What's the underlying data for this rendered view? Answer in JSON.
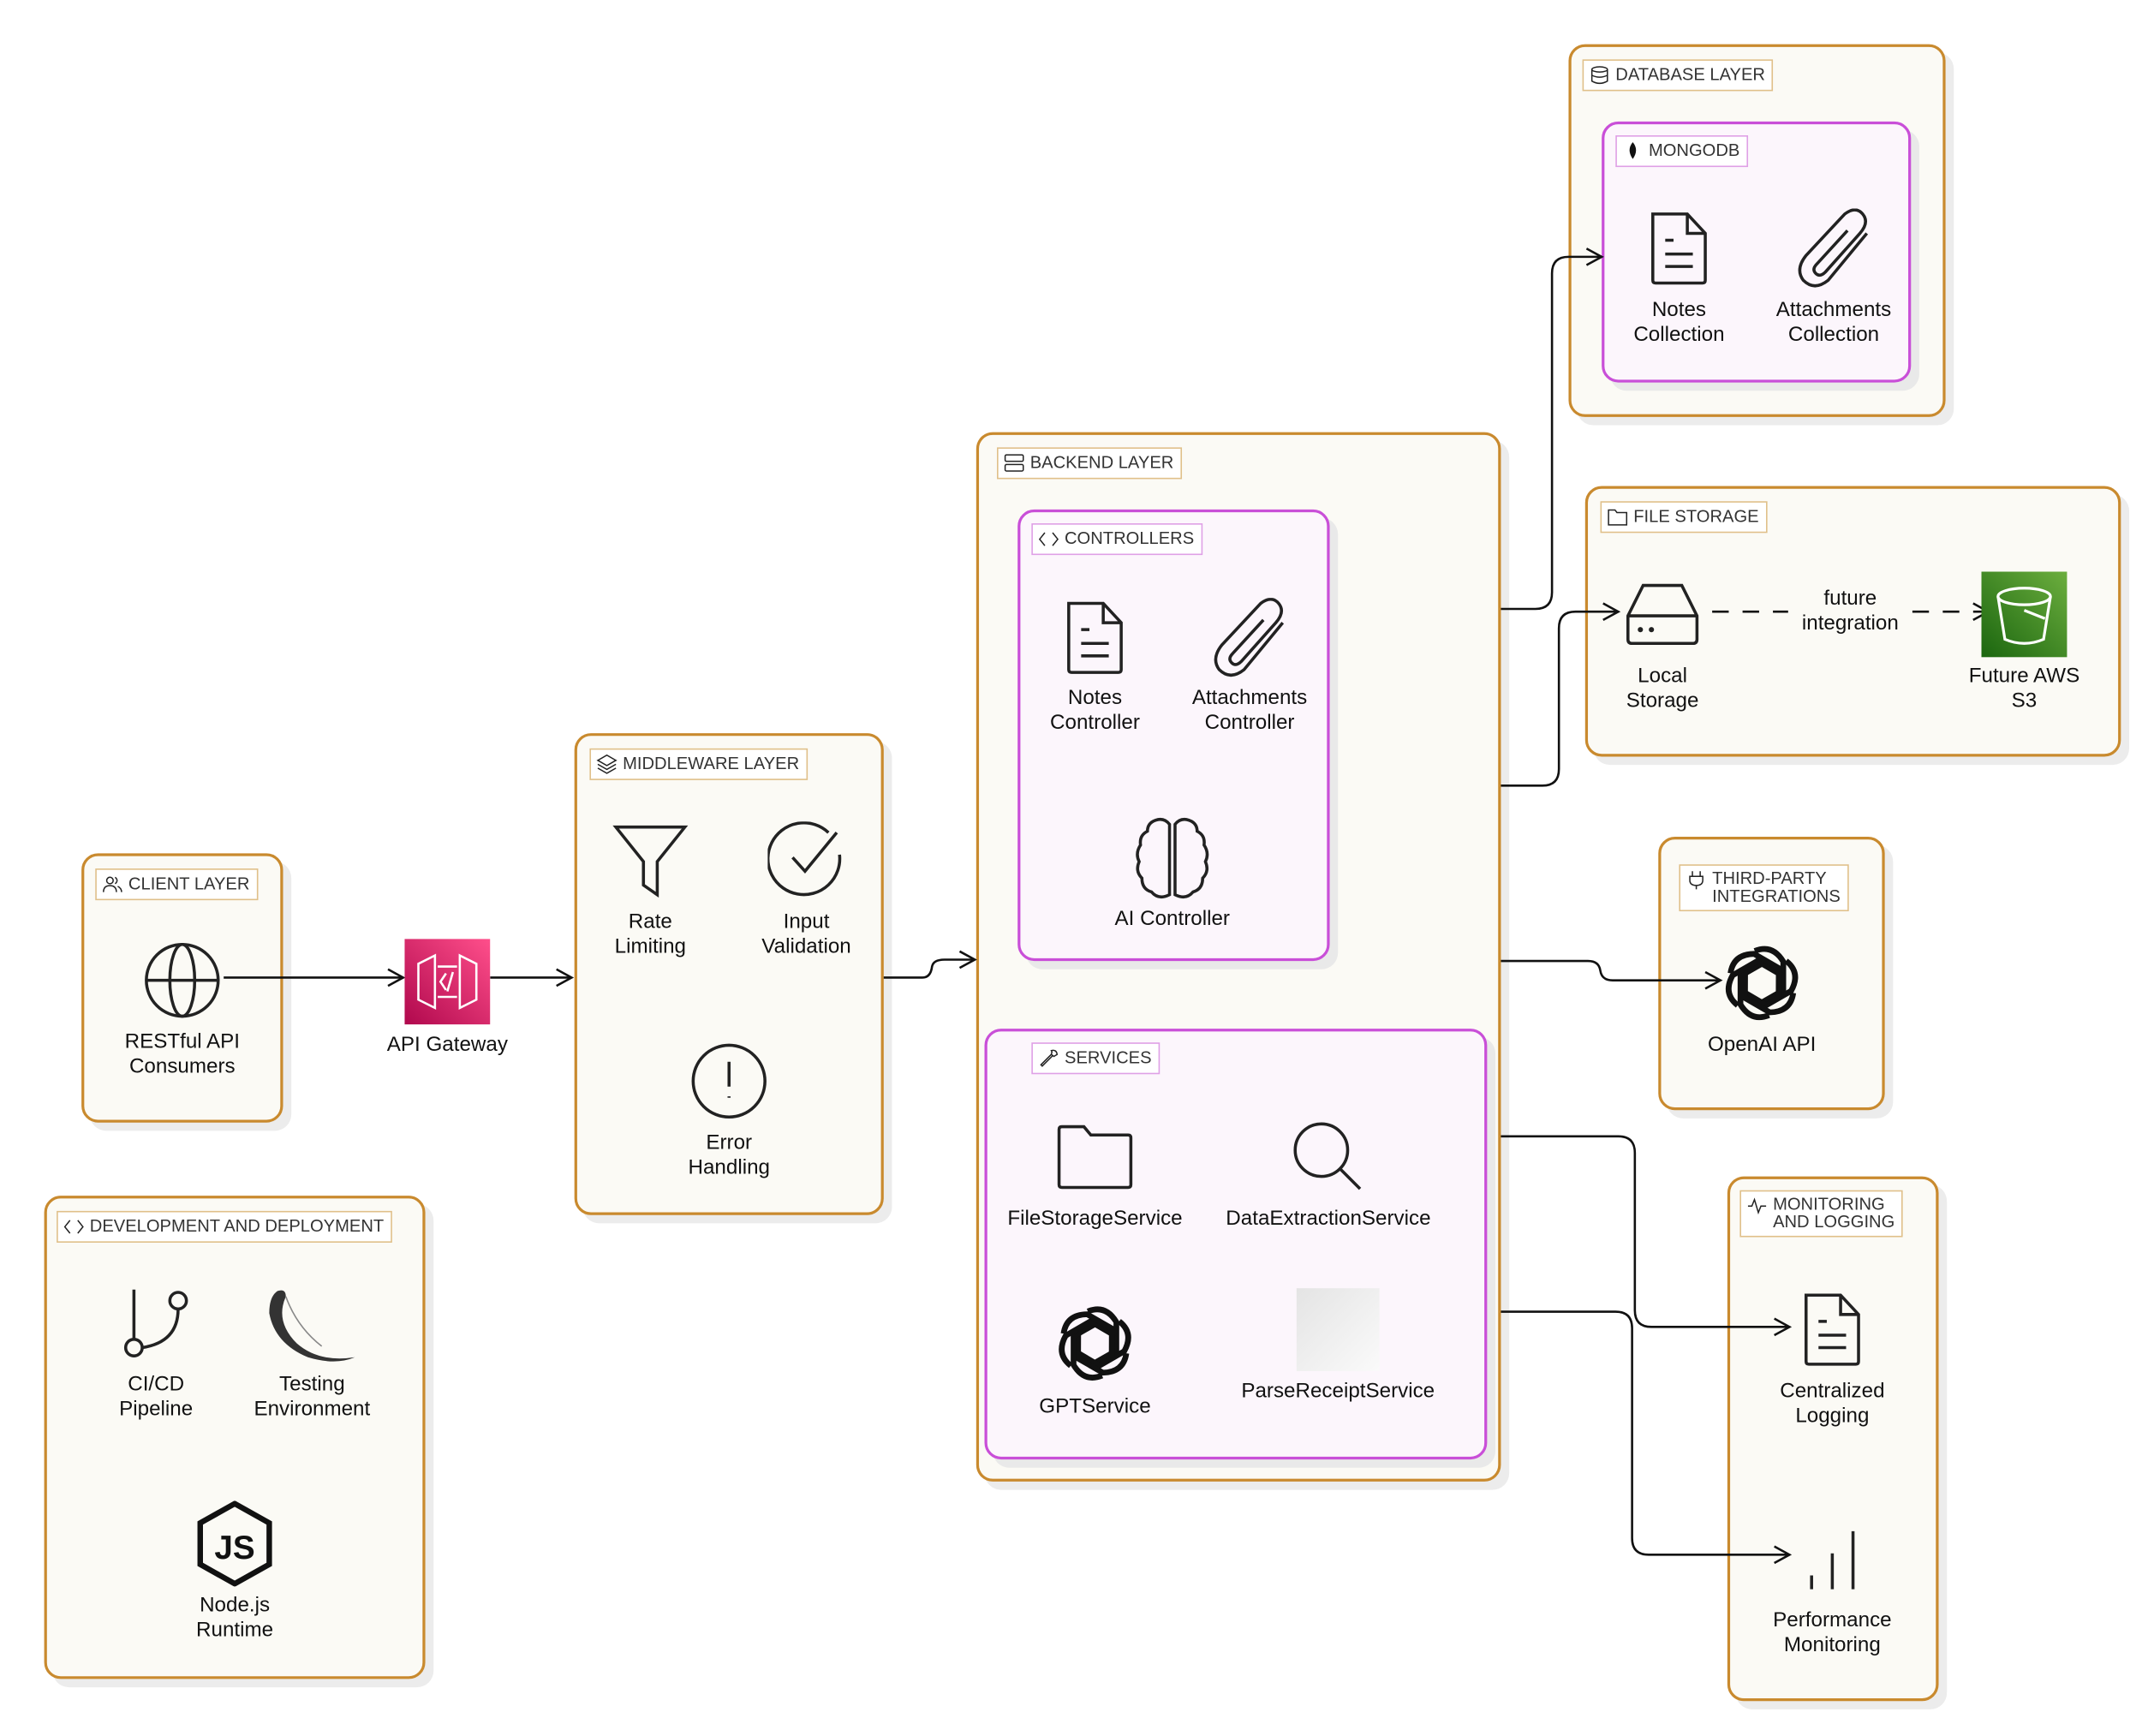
{
  "colors": {
    "layer_border": "#c98a2e",
    "group_border": "#c94fd8",
    "api_gateway": "#e7357a",
    "aws_s3": "#3f8f29"
  },
  "database_layer": {
    "title": "DATABASE LAYER",
    "icon": "database-icon",
    "mongodb": {
      "title": "MONGODB",
      "icon": "mongodb-leaf-icon",
      "items": [
        {
          "label": "Notes\nCollection",
          "icon": "document-icon"
        },
        {
          "label": "Attachments\nCollection",
          "icon": "paperclip-icon"
        }
      ]
    }
  },
  "backend_layer": {
    "title": "BACKEND LAYER",
    "icon": "server-icon",
    "controllers": {
      "title": "CONTROLLERS",
      "icon": "code-icon",
      "items": [
        {
          "label": "Notes\nController",
          "icon": "document-icon"
        },
        {
          "label": "Attachments\nController",
          "icon": "paperclip-icon"
        },
        {
          "label": "AI Controller",
          "icon": "brain-icon"
        }
      ]
    },
    "services": {
      "title": "SERVICES",
      "icon": "wrench-icon",
      "items": [
        {
          "label": "FileStorageService",
          "icon": "folder-icon"
        },
        {
          "label": "DataExtractionService",
          "icon": "search-icon"
        },
        {
          "label": "GPTService",
          "icon": "openai-icon"
        },
        {
          "label": "ParseReceiptService",
          "icon": "image-placeholder-icon"
        }
      ]
    }
  },
  "file_storage": {
    "title": "FILE STORAGE",
    "icon": "folder-icon",
    "items": [
      {
        "label": "Local\nStorage",
        "icon": "hard-drive-icon"
      },
      {
        "label": "Future AWS\nS3",
        "icon": "aws-s3-icon"
      }
    ],
    "edge_label": "future\nintegration"
  },
  "third_party": {
    "title": "THIRD-PARTY\nINTEGRATIONS",
    "icon": "plug-icon",
    "items": [
      {
        "label": "OpenAI API",
        "icon": "openai-icon"
      }
    ]
  },
  "monitoring": {
    "title": "MONITORING\nAND LOGGING",
    "icon": "activity-icon",
    "items": [
      {
        "label": "Centralized\nLogging",
        "icon": "document-icon"
      },
      {
        "label": "Performance\nMonitoring",
        "icon": "bar-chart-icon"
      }
    ]
  },
  "client_layer": {
    "title": "CLIENT LAYER",
    "icon": "users-icon",
    "items": [
      {
        "label": "RESTful API\nConsumers",
        "icon": "globe-icon"
      }
    ]
  },
  "api_gateway": {
    "label": "API Gateway",
    "icon": "aws-api-gateway-icon"
  },
  "middleware_layer": {
    "title": "MIDDLEWARE LAYER",
    "icon": "layers-icon",
    "items": [
      {
        "label": "Rate\nLimiting",
        "icon": "filter-icon"
      },
      {
        "label": "Input\nValidation",
        "icon": "check-circle-icon"
      },
      {
        "label": "Error\nHandling",
        "icon": "alert-circle-icon"
      }
    ]
  },
  "dev_deploy": {
    "title": "DEVELOPMENT AND DEPLOYMENT",
    "icon": "code-icon",
    "items": [
      {
        "label": "CI/CD\nPipeline",
        "icon": "git-branch-icon"
      },
      {
        "label": "Testing\nEnvironment",
        "icon": "flask-icon"
      },
      {
        "label": "Node.js\nRuntime",
        "icon": "nodejs-icon"
      }
    ]
  }
}
